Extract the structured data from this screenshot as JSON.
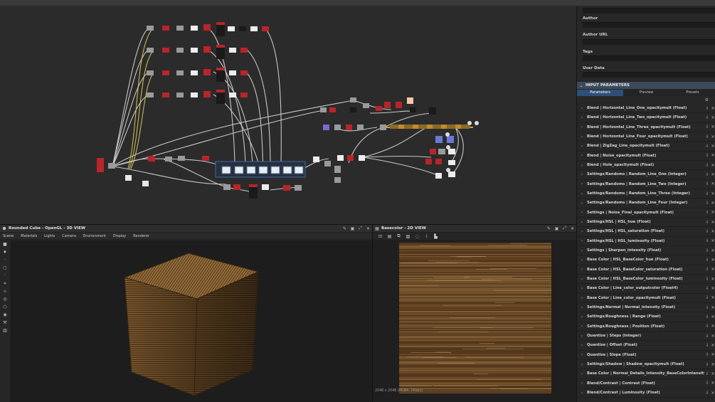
{
  "right_panel": {
    "meta_labels": {
      "author": "Author",
      "author_url": "Author URL",
      "tags": "Tags",
      "user_data": "User Data"
    },
    "input_parameters": {
      "title": "INPUT PARAMETERS",
      "tabs": [
        {
          "label": "Parameters",
          "active": true
        },
        {
          "label": "Preview",
          "active": false
        },
        {
          "label": "Presets",
          "active": false
        }
      ],
      "params": [
        "Blend | Horizontal_Line_One_opacitymult (Float)",
        "Blend | Horizontal_Line_Two_opacitymult (Float)",
        "Blend | Horizontal_Line_Three_opacitymult (Float)",
        "Blend | Horizontal_Line_Four_opacitymult (Float)",
        "Blend | ZigZag_Line_opacitymult (Float)",
        "Blend | Noise_opacitymult (Float)",
        "Blend | Hole_opacitymult (Float)",
        "Settings/Randoms | Random_Line_One (Integer)",
        "Settings/Randoms | Random_Line_Two (Integer)",
        "Settings/Randoms | Random_Line_Three (Integer)",
        "Settings/Randoms | Random_Line_Four (Integer)",
        "Settings | Noise_Final_opacitymult (Float)",
        "Settings/HSL | HSL_hue (Float)",
        "Settings/HSL | HSL_saturation (Float)",
        "Settings/HSL | HSL_luminosity (Float)",
        "Settings | Sharpen_intensity (Float)",
        "Base Color | HSL_BaseColor_hue (Float)",
        "Base Color | HSL_BaseColor_saturation (Float)",
        "Base Color | HSL_BaseColor_luminosity (Float)",
        "Base Color | Line_color_outputcolor (Float4)",
        "Base Color | Line_color_opacitymult (Float)",
        "Settings/Normal | Normal_intensity (Float)",
        "Settings/Roughness | Range (Float)",
        "Settings/Roughness | Position (Float)",
        "Quantize | Steps (Integer)",
        "Quantize | Offset (Float)",
        "Quantize | Slope (Float)",
        "Settings/Shadow | Shadow_opacitymult (Float)",
        "Base Color | Normal_Details_Intensity_BaseColorIntensity",
        "Blend/Contrast | Contrast (Float)",
        "Blend/Contrast | Luminosity (Float)"
      ]
    }
  },
  "view3d": {
    "title": "Rounded Cube - OpenGL - 3D VIEW",
    "menu": [
      "Scene",
      "Materials",
      "Lights",
      "Camera",
      "Environment",
      "Display",
      "Renderer"
    ]
  },
  "view2d": {
    "title": "Basecolor - 2D VIEW",
    "status": "2048 x 2048 (RGBA, 16bpc)"
  },
  "icons": {
    "param_arrow": "chevron-right-icon",
    "param_action": "pin-icon",
    "param_close": "close-icon",
    "panel_toolbar": [
      "pin-icon",
      "maximize-icon",
      "float-icon",
      "close-icon"
    ]
  },
  "colors": {
    "accent_tab": "#2f4e78",
    "section_header": "#3c4a5a",
    "node_red": "#b8242a",
    "node_blue": "#3f6aa8",
    "node_gold": "#c08a2a"
  }
}
